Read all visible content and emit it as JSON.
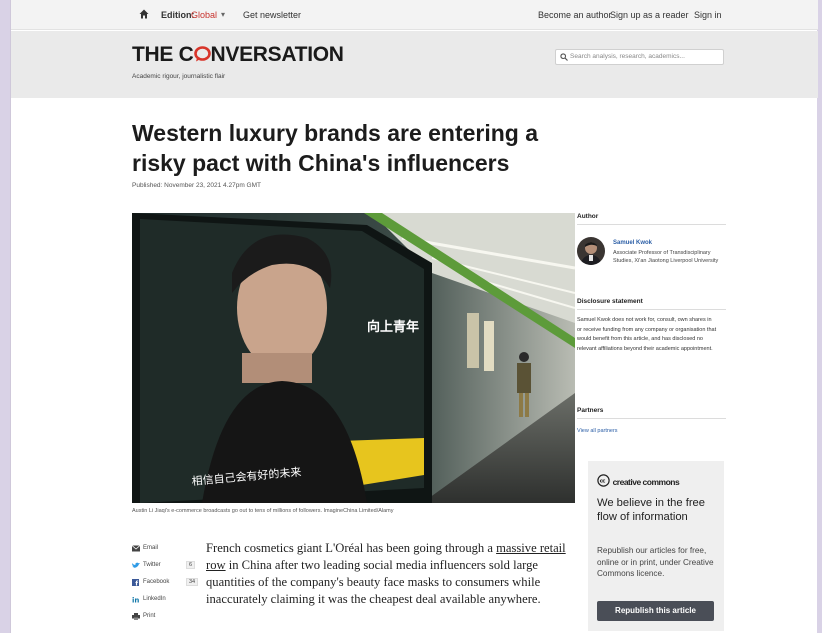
{
  "topbar": {
    "edition_label": "Edition:",
    "edition_value": "Global",
    "newsletter": "Get newsletter",
    "become_author": "Become an author",
    "sign_up": "Sign up as a reader",
    "sign_in": "Sign in"
  },
  "masthead": {
    "logo_pre": "THE C",
    "logo_post": "NVERSATION",
    "tagline": "Academic rigour, journalistic flair",
    "search_placeholder": "Search analysis, research, academics..."
  },
  "article": {
    "title": "Western luxury brands are entering a risky pact with China's influencers",
    "published": "Published: November 23, 2021 4.27pm GMT",
    "caption": "Austin Li Jiaqi's e-commerce broadcasts go out to tens of millions of followers. ImagineChina Limited/Alamy",
    "body_pre": "French cosmetics giant L'Oréal has been going through a ",
    "body_link": "massive retail row",
    "body_post": " in China after two leading social media influencers sold large quantities of the company's beauty face masks to consumers while inaccurately claiming it was the cheapest deal available anywhere."
  },
  "share": [
    {
      "label": "Email",
      "count": "",
      "icon": "email-icon"
    },
    {
      "label": "Twitter",
      "count": "6",
      "icon": "twitter-icon"
    },
    {
      "label": "Facebook",
      "count": "34",
      "icon": "facebook-icon"
    },
    {
      "label": "LinkedIn",
      "count": "",
      "icon": "linkedin-icon"
    },
    {
      "label": "Print",
      "count": "",
      "icon": "print-icon"
    }
  ],
  "sidebar": {
    "author_heading": "Author",
    "author_name": "Samuel Kwok",
    "author_role": "Associate Professor of Transdisciplinary Studies, Xi'an Jiaotong Liverpool University",
    "disclosure_heading": "Disclosure statement",
    "disclosure_text": "Samuel Kwok does not work for, consult, own shares in or receive funding from any company or organisation that would benefit from this article, and has disclosed no relevant affiliations beyond their academic appointment.",
    "partners_heading": "Partners",
    "partners_link": "View all partners"
  },
  "cc": {
    "logo": "creative commons",
    "heading": "We believe in the free flow of information",
    "text": "Republish our articles for free, online or in print, under Creative Commons licence.",
    "button": "Republish this article"
  },
  "hero": {
    "poster_text": "向上青年",
    "poster_subtext": "相信自己会有好的未来"
  },
  "colors": {
    "brand_red": "#d8352a",
    "link_blue": "#2b5ea6",
    "button_dark": "#4a4e57"
  }
}
